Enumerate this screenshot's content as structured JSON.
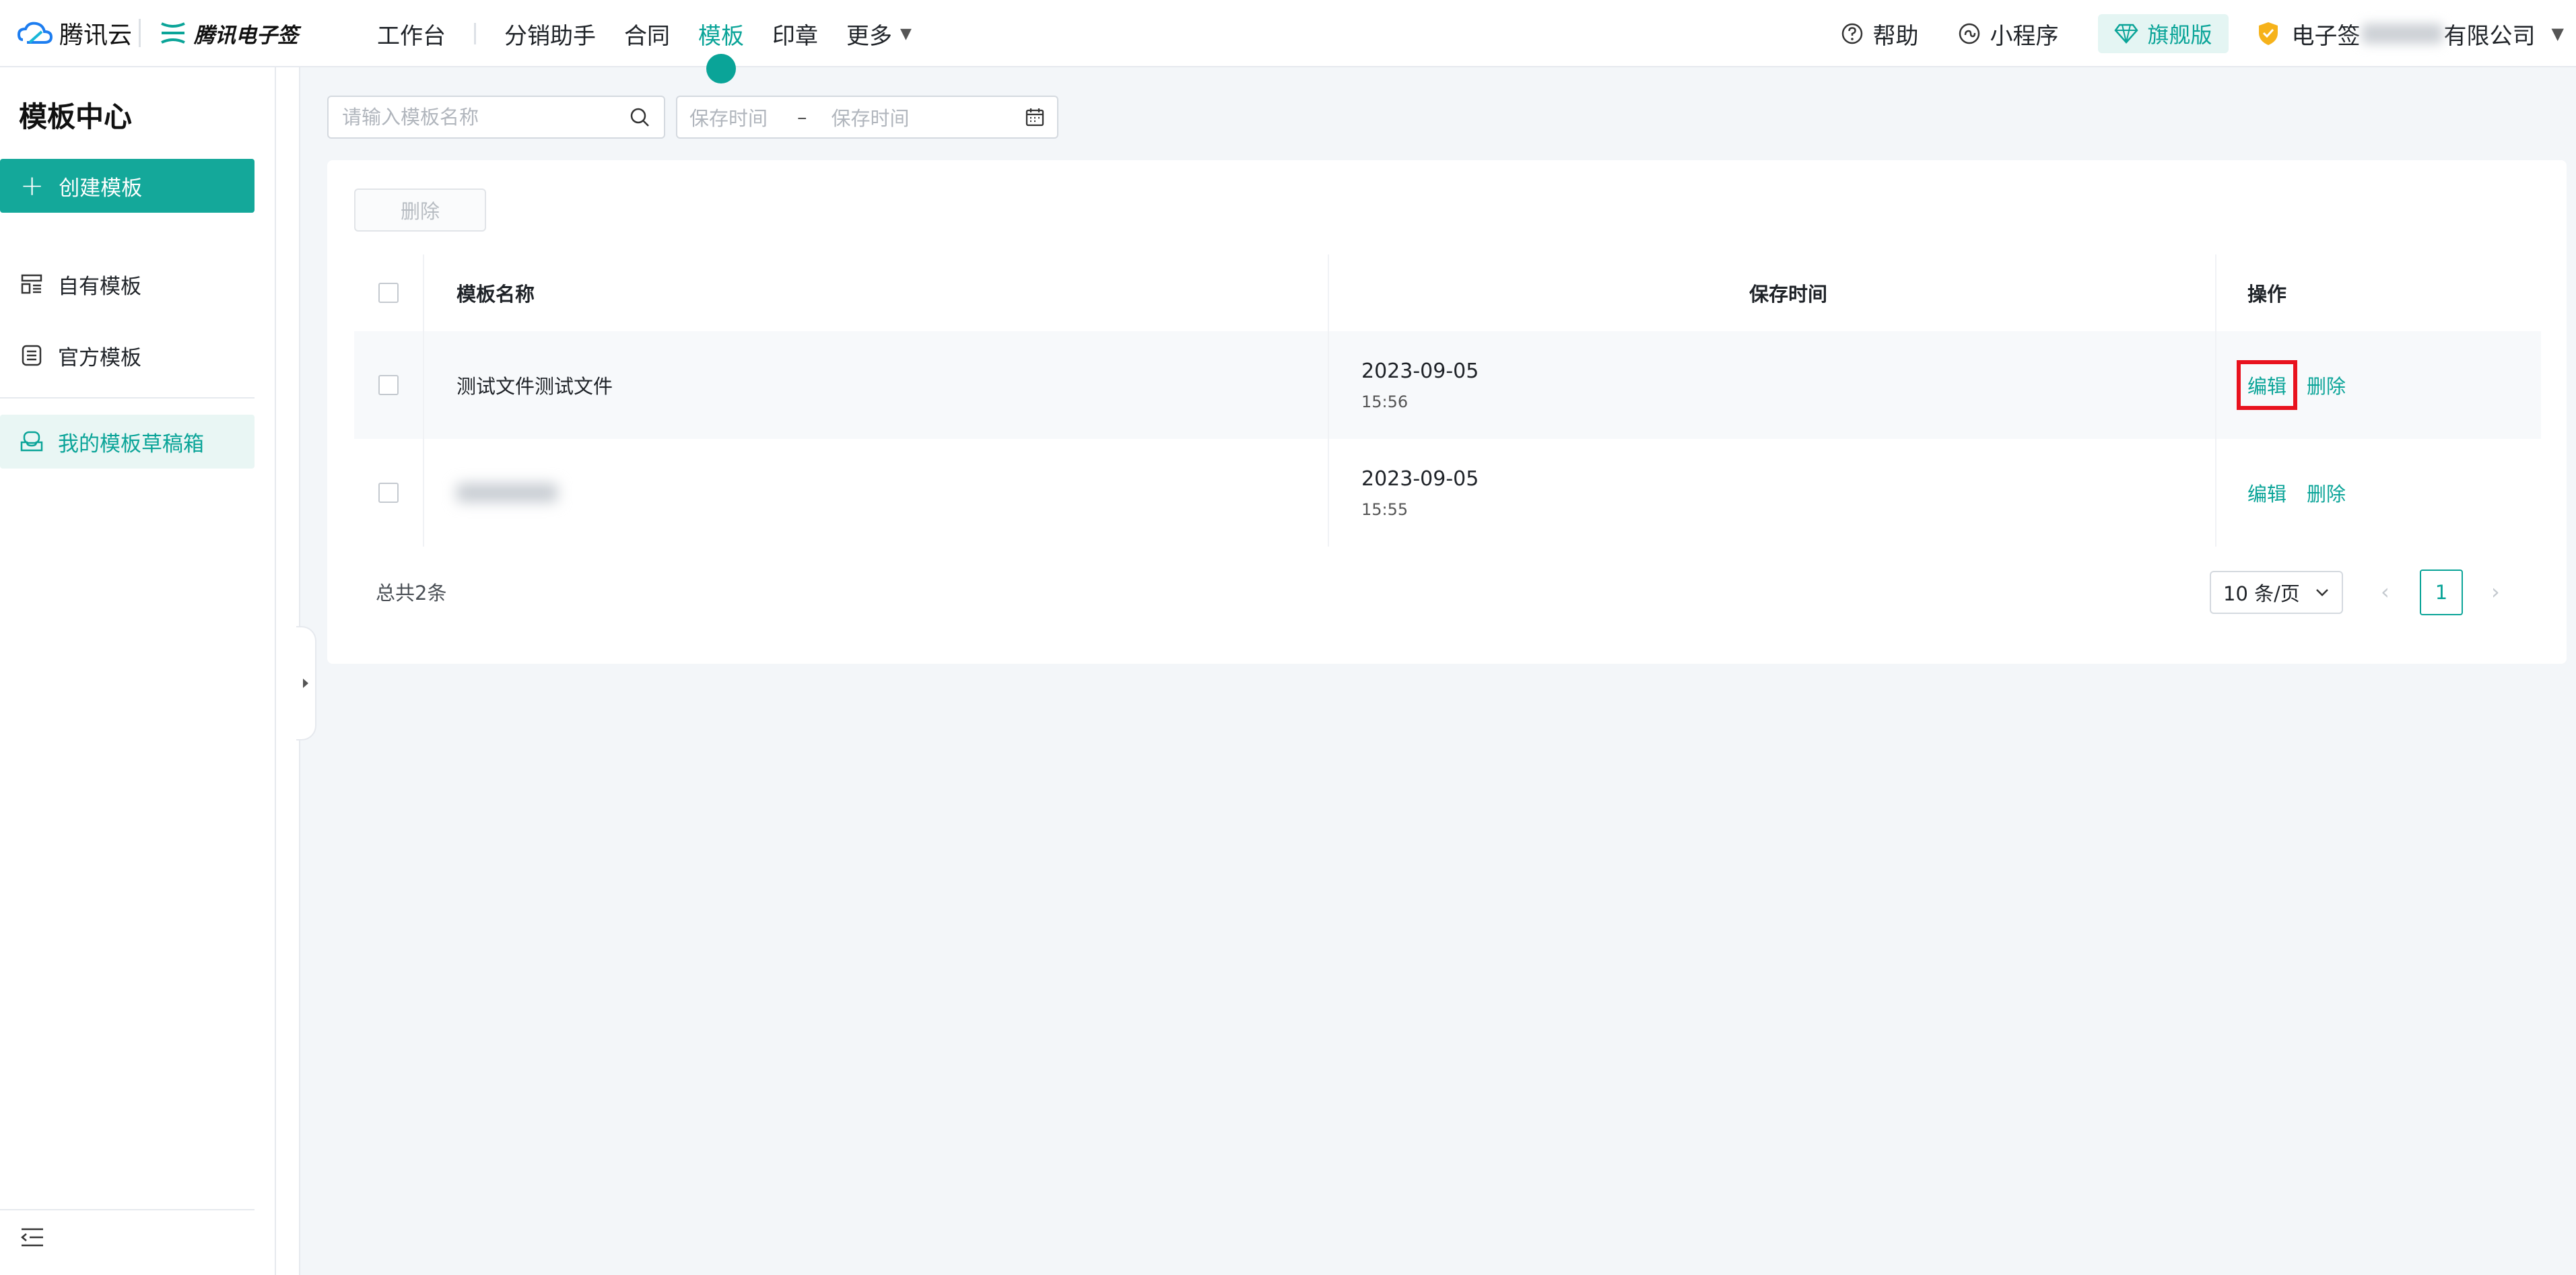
{
  "brand": {
    "tencent_cloud": "腾讯云",
    "esign": "腾讯电子签"
  },
  "nav": {
    "items": [
      {
        "label": "工作台"
      },
      {
        "label": "分销助手"
      },
      {
        "label": "合同"
      },
      {
        "label": "模板"
      },
      {
        "label": "印章"
      },
      {
        "label": "更多"
      }
    ],
    "active": "模板"
  },
  "top_right": {
    "help": "帮助",
    "mini_program": "小程序",
    "edition": "旗舰版",
    "company_prefix": "电子签",
    "company_suffix": "有限公司"
  },
  "sidebar": {
    "title": "模板中心",
    "create_button": "创建模板",
    "items": [
      {
        "label": "自有模板",
        "icon": "layout-template-icon"
      },
      {
        "label": "官方模板",
        "icon": "official-template-icon"
      },
      {
        "label": "我的模板草稿箱",
        "icon": "draft-box-icon"
      }
    ],
    "active": "我的模板草稿箱"
  },
  "filters": {
    "search_placeholder": "请输入模板名称",
    "date_start_placeholder": "保存时间",
    "date_end_placeholder": "保存时间"
  },
  "toolbar": {
    "delete_label": "删除"
  },
  "table": {
    "columns": [
      "模板名称",
      "保存时间",
      "操作"
    ],
    "rows": [
      {
        "name": "测试文件测试文件",
        "date": "2023-09-05",
        "time": "15:56",
        "edit": "编辑",
        "delete": "删除"
      },
      {
        "name": "",
        "date": "2023-09-05",
        "time": "15:55",
        "edit": "编辑",
        "delete": "删除"
      }
    ]
  },
  "pagination": {
    "total": "总共2条",
    "page_size": "10 条/页",
    "current_page": "1"
  },
  "colors": {
    "accent": "#0aa498",
    "highlight_box": "#e8121e"
  }
}
